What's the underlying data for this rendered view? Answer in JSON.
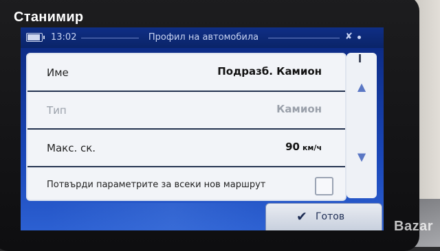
{
  "photo": {
    "owner_label": "Станимир",
    "watermark": "Bazar"
  },
  "status_bar": {
    "time": "13:02",
    "title": "Профил на автомобила",
    "battery_icon": "battery-icon",
    "gps_icon": "gps-satellite-icon"
  },
  "rows": [
    {
      "label": "Име",
      "value": "Подразб. Камион",
      "enabled": true
    },
    {
      "label": "Тип",
      "value": "Камион",
      "enabled": false
    },
    {
      "label": "Макс. ск.",
      "value": "90",
      "unit": "км/ч",
      "enabled": true
    }
  ],
  "checkbox_row": {
    "label": "Потвърди параметрите за всеки нов маршрут",
    "checked": false
  },
  "scroll": {
    "up_icon": "▲",
    "down_icon": "▼"
  },
  "done_button": {
    "icon": "✔",
    "label": "Готов"
  },
  "colors": {
    "header_bg": "#0f2e86",
    "panel_bg": "#f0f2f6",
    "accent": "#1a47b8"
  }
}
